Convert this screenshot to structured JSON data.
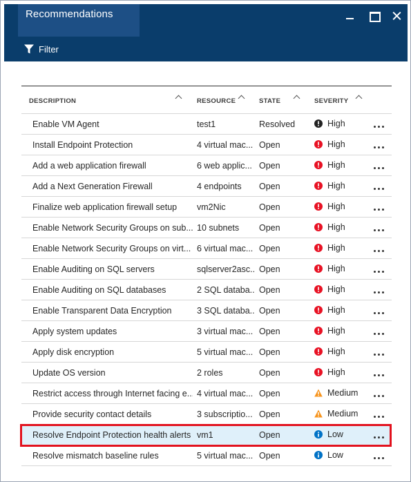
{
  "blade": {
    "title": "Recommendations",
    "filter_label": "Filter"
  },
  "colors": {
    "header_bg": "#0a3d6b",
    "title_block_bg": "#1d4f85",
    "selected_row_bg": "#dff0fa",
    "highlight_border": "#e2111d",
    "severity_high": "#e81123",
    "severity_resolved": "#222222",
    "severity_medium": "#f7941d",
    "severity_low": "#0072c6"
  },
  "table": {
    "columns": {
      "description": "DESCRIPTION",
      "resource": "RESOURCE",
      "state": "STATE",
      "severity": "SEVERITY"
    },
    "rows": [
      {
        "description": "Enable VM Agent",
        "resource": "test1",
        "state": "Resolved",
        "severity": "High",
        "severity_icon": "resolved-high-icon"
      },
      {
        "description": "Install Endpoint Protection",
        "resource": "4 virtual mac...",
        "state": "Open",
        "severity": "High",
        "severity_icon": "high-severity-icon"
      },
      {
        "description": "Add a web application firewall",
        "resource": "6 web applic...",
        "state": "Open",
        "severity": "High",
        "severity_icon": "high-severity-icon"
      },
      {
        "description": "Add a Next Generation Firewall",
        "resource": "4 endpoints",
        "state": "Open",
        "severity": "High",
        "severity_icon": "high-severity-icon"
      },
      {
        "description": "Finalize web application firewall setup",
        "resource": "vm2Nic",
        "state": "Open",
        "severity": "High",
        "severity_icon": "high-severity-icon"
      },
      {
        "description": "Enable Network Security Groups on sub...",
        "resource": "10 subnets",
        "state": "Open",
        "severity": "High",
        "severity_icon": "high-severity-icon"
      },
      {
        "description": "Enable Network Security Groups on virt...",
        "resource": "6 virtual mac...",
        "state": "Open",
        "severity": "High",
        "severity_icon": "high-severity-icon"
      },
      {
        "description": "Enable Auditing on SQL servers",
        "resource": "sqlserver2asc...",
        "state": "Open",
        "severity": "High",
        "severity_icon": "high-severity-icon"
      },
      {
        "description": "Enable Auditing on SQL databases",
        "resource": "2 SQL databa...",
        "state": "Open",
        "severity": "High",
        "severity_icon": "high-severity-icon"
      },
      {
        "description": "Enable Transparent Data Encryption",
        "resource": "3 SQL databa...",
        "state": "Open",
        "severity": "High",
        "severity_icon": "high-severity-icon"
      },
      {
        "description": "Apply system updates",
        "resource": "3 virtual mac...",
        "state": "Open",
        "severity": "High",
        "severity_icon": "high-severity-icon"
      },
      {
        "description": "Apply disk encryption",
        "resource": "5 virtual mac...",
        "state": "Open",
        "severity": "High",
        "severity_icon": "high-severity-icon"
      },
      {
        "description": "Update OS version",
        "resource": "2 roles",
        "state": "Open",
        "severity": "High",
        "severity_icon": "high-severity-icon"
      },
      {
        "description": "Restrict access through Internet facing e...",
        "resource": "4 virtual mac...",
        "state": "Open",
        "severity": "Medium",
        "severity_icon": "medium-severity-icon"
      },
      {
        "description": "Provide security contact details",
        "resource": "3 subscriptio...",
        "state": "Open",
        "severity": "Medium",
        "severity_icon": "medium-severity-icon"
      },
      {
        "description": "Resolve Endpoint Protection health alerts",
        "resource": "vm1",
        "state": "Open",
        "severity": "Low",
        "severity_icon": "low-severity-icon",
        "selected": true
      },
      {
        "description": "Resolve mismatch baseline rules",
        "resource": "5 virtual mac...",
        "state": "Open",
        "severity": "Low",
        "severity_icon": "low-severity-icon"
      }
    ]
  }
}
